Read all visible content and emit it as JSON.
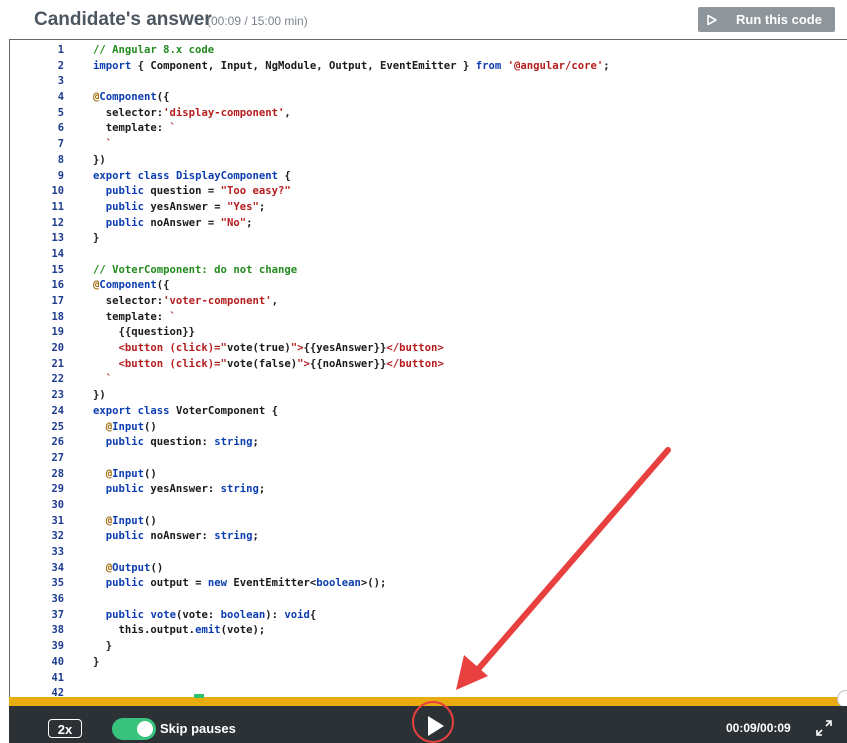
{
  "header": {
    "title": "Candidate's answer",
    "subtitle": "(00:09 / 15:00 min)",
    "run_label": "Run this code",
    "run_icon": "play-icon"
  },
  "editor": {
    "lines": [
      {
        "n": "1",
        "tokens": [
          {
            "c": "c",
            "t": "// Angular 8.x code"
          }
        ]
      },
      {
        "n": "2",
        "tokens": [
          {
            "c": "k",
            "t": "import"
          },
          {
            "c": "n",
            "t": " { Component, Input, NgModule, Output, EventEmitter } "
          },
          {
            "c": "k",
            "t": "from"
          },
          {
            "c": "n",
            "t": " "
          },
          {
            "c": "s",
            "t": "'@angular/core'"
          },
          {
            "c": "n",
            "t": ";"
          }
        ]
      },
      {
        "n": "3",
        "tokens": []
      },
      {
        "n": "4",
        "tokens": [
          {
            "c": "d",
            "t": "@"
          },
          {
            "c": "k",
            "t": "Component"
          },
          {
            "c": "n",
            "t": "({"
          }
        ]
      },
      {
        "n": "5",
        "tokens": [
          {
            "c": "n",
            "t": "  selector:"
          },
          {
            "c": "s",
            "t": "'display-component'"
          },
          {
            "c": "n",
            "t": ","
          }
        ]
      },
      {
        "n": "6",
        "tokens": [
          {
            "c": "n",
            "t": "  template: "
          },
          {
            "c": "s",
            "t": "`"
          }
        ]
      },
      {
        "n": "7",
        "tokens": [
          {
            "c": "s",
            "t": "  `"
          }
        ]
      },
      {
        "n": "8",
        "tokens": [
          {
            "c": "n",
            "t": "})"
          }
        ]
      },
      {
        "n": "9",
        "tokens": [
          {
            "c": "k",
            "t": "export"
          },
          {
            "c": "n",
            "t": " "
          },
          {
            "c": "k",
            "t": "class"
          },
          {
            "c": "n",
            "t": " "
          },
          {
            "c": "k",
            "t": "DisplayComponent"
          },
          {
            "c": "n",
            "t": " {"
          }
        ]
      },
      {
        "n": "10",
        "tokens": [
          {
            "c": "n",
            "t": "  "
          },
          {
            "c": "k",
            "t": "public"
          },
          {
            "c": "n",
            "t": " question = "
          },
          {
            "c": "s",
            "t": "\"Too easy?\""
          }
        ]
      },
      {
        "n": "11",
        "tokens": [
          {
            "c": "n",
            "t": "  "
          },
          {
            "c": "k",
            "t": "public"
          },
          {
            "c": "n",
            "t": " yesAnswer = "
          },
          {
            "c": "s",
            "t": "\"Yes\""
          },
          {
            "c": "n",
            "t": ";"
          }
        ]
      },
      {
        "n": "12",
        "tokens": [
          {
            "c": "n",
            "t": "  "
          },
          {
            "c": "k",
            "t": "public"
          },
          {
            "c": "n",
            "t": " noAnswer = "
          },
          {
            "c": "s",
            "t": "\"No\""
          },
          {
            "c": "n",
            "t": ";"
          }
        ]
      },
      {
        "n": "13",
        "tokens": [
          {
            "c": "n",
            "t": "}"
          }
        ]
      },
      {
        "n": "14",
        "tokens": []
      },
      {
        "n": "15",
        "tokens": [
          {
            "c": "c",
            "t": "// VoterComponent: do not change"
          }
        ]
      },
      {
        "n": "16",
        "tokens": [
          {
            "c": "d",
            "t": "@"
          },
          {
            "c": "k",
            "t": "Component"
          },
          {
            "c": "n",
            "t": "({"
          }
        ]
      },
      {
        "n": "17",
        "tokens": [
          {
            "c": "n",
            "t": "  selector:"
          },
          {
            "c": "s",
            "t": "'voter-component'"
          },
          {
            "c": "n",
            "t": ","
          }
        ]
      },
      {
        "n": "18",
        "tokens": [
          {
            "c": "n",
            "t": "  template: "
          },
          {
            "c": "s",
            "t": "`"
          }
        ]
      },
      {
        "n": "19",
        "tokens": [
          {
            "c": "n",
            "t": "    {{question}}"
          }
        ]
      },
      {
        "n": "20",
        "tokens": [
          {
            "c": "s",
            "t": "    <button (click)=\""
          },
          {
            "c": "n",
            "t": "vote(true)"
          },
          {
            "c": "s",
            "t": "\">"
          },
          {
            "c": "n",
            "t": "{{yesAnswer}}"
          },
          {
            "c": "s",
            "t": "</button>"
          }
        ]
      },
      {
        "n": "21",
        "tokens": [
          {
            "c": "s",
            "t": "    <button (click)=\""
          },
          {
            "c": "n",
            "t": "vote(false)"
          },
          {
            "c": "s",
            "t": "\">"
          },
          {
            "c": "n",
            "t": "{{noAnswer}}"
          },
          {
            "c": "s",
            "t": "</button>"
          }
        ]
      },
      {
        "n": "22",
        "tokens": [
          {
            "c": "s",
            "t": "  `"
          }
        ]
      },
      {
        "n": "23",
        "tokens": [
          {
            "c": "n",
            "t": "})"
          }
        ]
      },
      {
        "n": "24",
        "tokens": [
          {
            "c": "k",
            "t": "export"
          },
          {
            "c": "n",
            "t": " "
          },
          {
            "c": "k",
            "t": "class"
          },
          {
            "c": "n",
            "t": " VoterComponent {"
          }
        ]
      },
      {
        "n": "25",
        "tokens": [
          {
            "c": "n",
            "t": "  "
          },
          {
            "c": "d",
            "t": "@"
          },
          {
            "c": "k",
            "t": "Input"
          },
          {
            "c": "n",
            "t": "()"
          }
        ]
      },
      {
        "n": "26",
        "tokens": [
          {
            "c": "n",
            "t": "  "
          },
          {
            "c": "k",
            "t": "public"
          },
          {
            "c": "n",
            "t": " question: "
          },
          {
            "c": "k",
            "t": "string"
          },
          {
            "c": "n",
            "t": ";"
          }
        ]
      },
      {
        "n": "27",
        "tokens": []
      },
      {
        "n": "28",
        "tokens": [
          {
            "c": "n",
            "t": "  "
          },
          {
            "c": "d",
            "t": "@"
          },
          {
            "c": "k",
            "t": "Input"
          },
          {
            "c": "n",
            "t": "()"
          }
        ]
      },
      {
        "n": "29",
        "tokens": [
          {
            "c": "n",
            "t": "  "
          },
          {
            "c": "k",
            "t": "public"
          },
          {
            "c": "n",
            "t": " yesAnswer: "
          },
          {
            "c": "k",
            "t": "string"
          },
          {
            "c": "n",
            "t": ";"
          }
        ]
      },
      {
        "n": "30",
        "tokens": []
      },
      {
        "n": "31",
        "tokens": [
          {
            "c": "n",
            "t": "  "
          },
          {
            "c": "d",
            "t": "@"
          },
          {
            "c": "k",
            "t": "Input"
          },
          {
            "c": "n",
            "t": "()"
          }
        ]
      },
      {
        "n": "32",
        "tokens": [
          {
            "c": "n",
            "t": "  "
          },
          {
            "c": "k",
            "t": "public"
          },
          {
            "c": "n",
            "t": " noAnswer: "
          },
          {
            "c": "k",
            "t": "string"
          },
          {
            "c": "n",
            "t": ";"
          }
        ]
      },
      {
        "n": "33",
        "tokens": []
      },
      {
        "n": "34",
        "tokens": [
          {
            "c": "n",
            "t": "  "
          },
          {
            "c": "d",
            "t": "@"
          },
          {
            "c": "k",
            "t": "Output"
          },
          {
            "c": "n",
            "t": "()"
          }
        ]
      },
      {
        "n": "35",
        "tokens": [
          {
            "c": "n",
            "t": "  "
          },
          {
            "c": "k",
            "t": "public"
          },
          {
            "c": "n",
            "t": " output = "
          },
          {
            "c": "k",
            "t": "new"
          },
          {
            "c": "n",
            "t": " EventEmitter<"
          },
          {
            "c": "k",
            "t": "boolean"
          },
          {
            "c": "n",
            "t": ">();"
          }
        ]
      },
      {
        "n": "36",
        "tokens": []
      },
      {
        "n": "37",
        "tokens": [
          {
            "c": "n",
            "t": "  "
          },
          {
            "c": "k",
            "t": "public"
          },
          {
            "c": "n",
            "t": " "
          },
          {
            "c": "k",
            "t": "vote"
          },
          {
            "c": "n",
            "t": "(vote: "
          },
          {
            "c": "k",
            "t": "boolean"
          },
          {
            "c": "n",
            "t": "): "
          },
          {
            "c": "k",
            "t": "void"
          },
          {
            "c": "n",
            "t": "{"
          }
        ]
      },
      {
        "n": "38",
        "tokens": [
          {
            "c": "n",
            "t": "    this.output."
          },
          {
            "c": "k",
            "t": "emit"
          },
          {
            "c": "n",
            "t": "(vote);"
          }
        ]
      },
      {
        "n": "39",
        "tokens": [
          {
            "c": "n",
            "t": "  }"
          }
        ]
      },
      {
        "n": "40",
        "tokens": [
          {
            "c": "n",
            "t": "}"
          }
        ]
      },
      {
        "n": "41",
        "tokens": []
      },
      {
        "n": "42",
        "tokens": []
      }
    ]
  },
  "player": {
    "speed_label": "2x",
    "skip_label": "Skip pauses",
    "skip_enabled": true,
    "time_label": "00:09/00:09",
    "progress_fraction": 1.0,
    "play_icon": "play-icon",
    "fullscreen_icon": "fullscreen-icon"
  },
  "colors": {
    "progress": "#e9ac0e",
    "toggle_on": "#38c37c",
    "player_bg": "#2c3136",
    "annotation": "#e8403f"
  }
}
